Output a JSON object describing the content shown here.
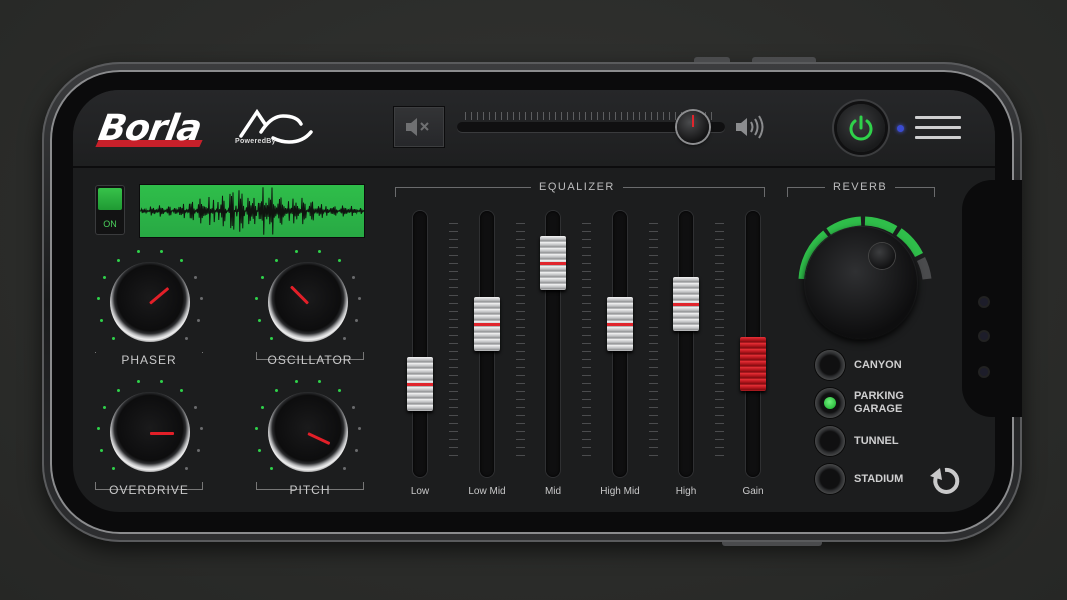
{
  "brand": {
    "logo_text": "Borla",
    "ac_logo": "AC",
    "powered_by": "PoweredBy"
  },
  "colors": {
    "accent_green": "#2fbe4a",
    "accent_red": "#e0252d",
    "background": "#1c1d1e",
    "led_blue": "#3a4bd0"
  },
  "topbar": {
    "mute_icon": "speaker-mute-icon",
    "volume_level": 0.88,
    "speaker_icon": "speaker-loud-icon",
    "power_icon": "power-icon",
    "menu_icon": "hamburger-menu-icon"
  },
  "synth": {
    "on_label": "ON",
    "knobs": [
      {
        "label": "PHASER"
      },
      {
        "label": "OSCILLATOR"
      },
      {
        "label": "OVERDRIVE"
      },
      {
        "label": "PITCH"
      }
    ]
  },
  "equalizer": {
    "title": "EQUALIZER",
    "bands": [
      {
        "label": "Low",
        "level": 0.3
      },
      {
        "label": "Low Mid",
        "level": 0.6
      },
      {
        "label": "Mid",
        "level": 0.9
      },
      {
        "label": "High Mid",
        "level": 0.6
      },
      {
        "label": "High",
        "level": 0.7
      },
      {
        "label": "Gain",
        "level": 0.4
      }
    ]
  },
  "reverb": {
    "title": "REVERB",
    "options": [
      {
        "label": "CANYON",
        "selected": false
      },
      {
        "label": "PARKING GARAGE",
        "selected": true
      },
      {
        "label": "TUNNEL",
        "selected": false
      },
      {
        "label": "STADIUM",
        "selected": false
      }
    ],
    "reset_icon": "reset-icon"
  }
}
